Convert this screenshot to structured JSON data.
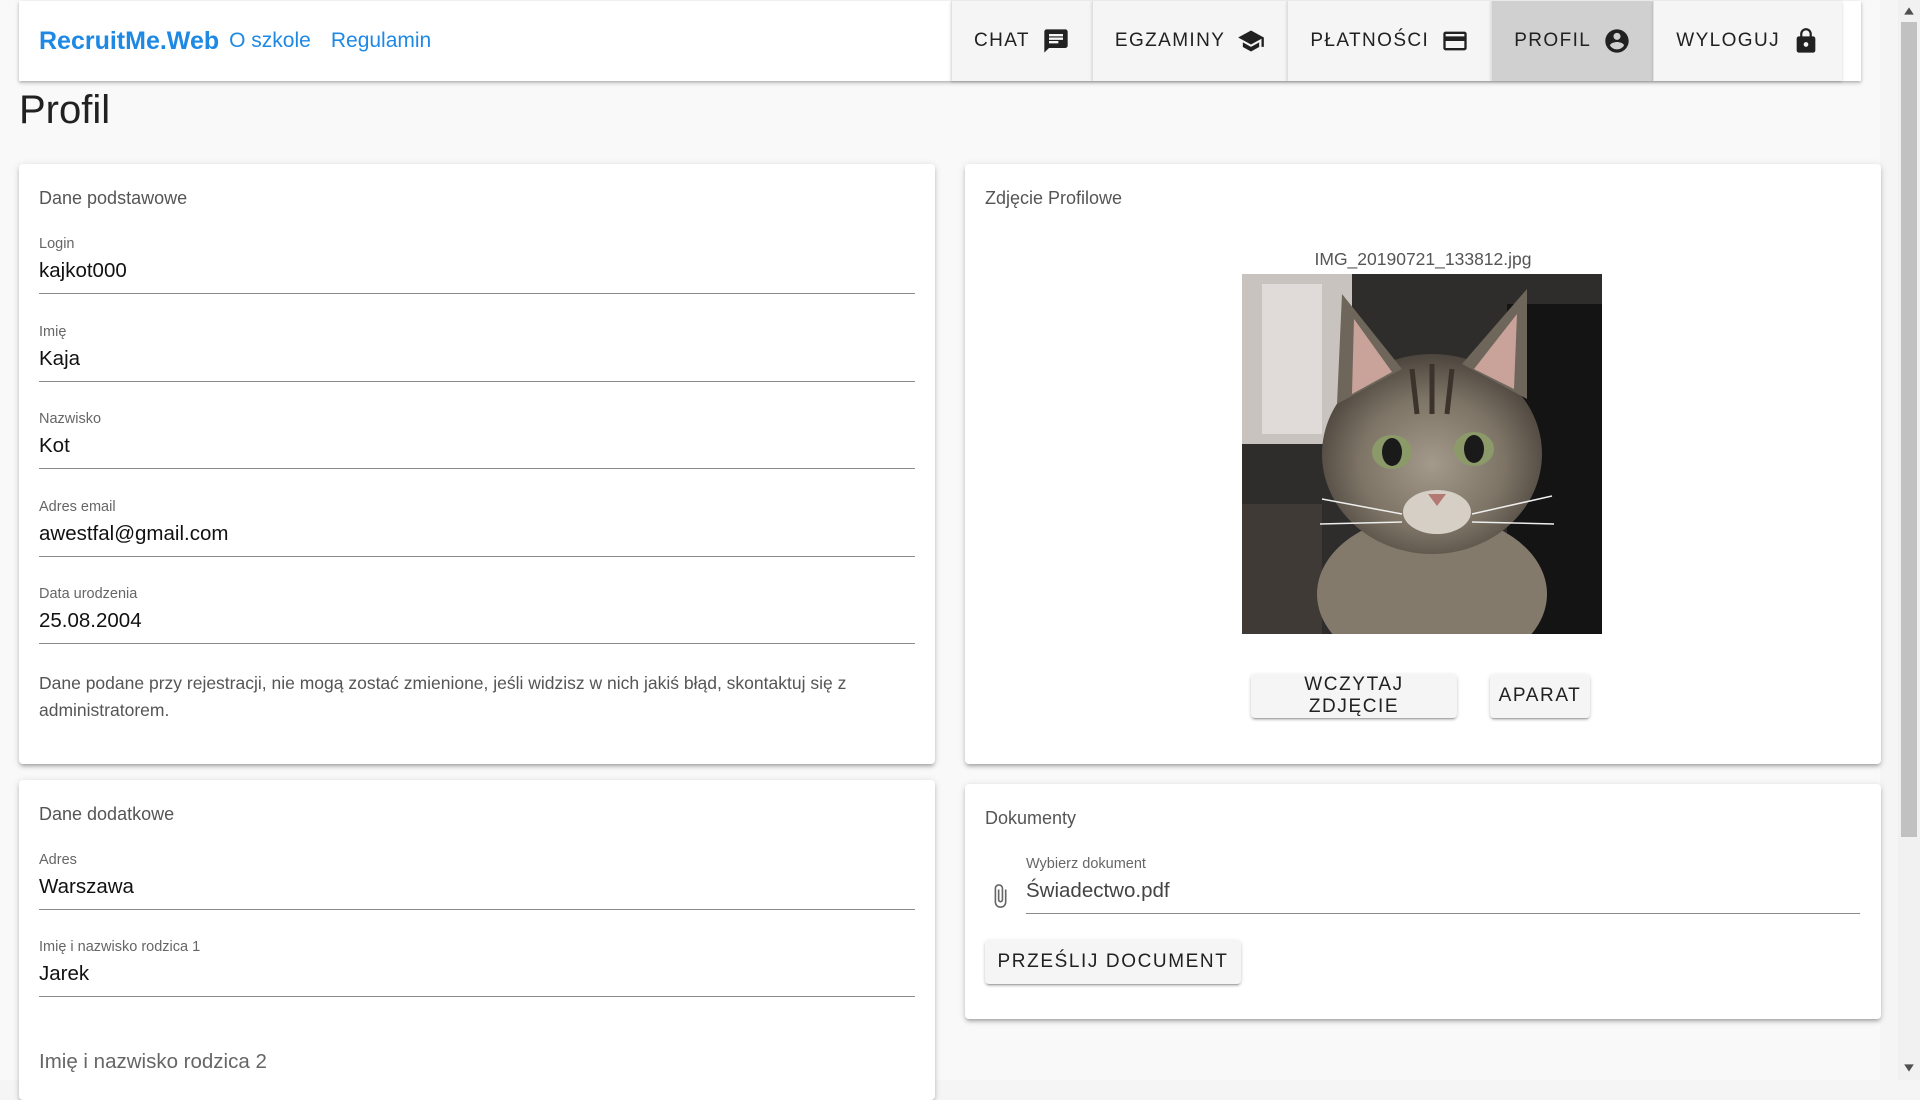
{
  "header": {
    "brand": "RecruitMe.Web",
    "links": [
      "O szkole",
      "Regulamin"
    ],
    "nav": {
      "chat": "CHAT",
      "exams": "EGZAMINY",
      "payments": "PŁATNOŚCI",
      "profile": "PROFIL",
      "logout": "WYLOGUJ"
    },
    "active": "PROFIL"
  },
  "page": {
    "title": "Profil"
  },
  "basic_data": {
    "title": "Dane podstawowe",
    "fields": [
      {
        "label": "Login",
        "value": "kajkot000"
      },
      {
        "label": "Imię",
        "value": "Kaja"
      },
      {
        "label": "Nazwisko",
        "value": "Kot"
      },
      {
        "label": "Adres email",
        "value": "awestfal@gmail.com"
      },
      {
        "label": "Data urodzenia",
        "value": "25.08.2004"
      }
    ],
    "note": "Dane podane przy rejestracji, nie mogą zostać zmienione, jeśli widzisz w nich jakiś błąd, skontaktuj się z administratorem."
  },
  "photo": {
    "title": "Zdjęcie Profilowe",
    "filename": "IMG_20190721_133812.jpg",
    "load_button": "WCZYTAJ ZDJĘCIE",
    "camera_button": "APARAT"
  },
  "extra_data": {
    "title": "Dane dodatkowe",
    "fields": [
      {
        "label": "Adres",
        "value": "Warszawa"
      },
      {
        "label": "Imię i nazwisko rodzica 1",
        "value": "Jarek"
      }
    ],
    "parent2_placeholder": "Imię i nazwisko rodzica 2"
  },
  "documents": {
    "title": "Dokumenty",
    "label": "Wybierz dokument",
    "value": "Świadectwo.pdf",
    "upload_button": "PRZEŚLIJ DOCUMENT"
  },
  "colors": {
    "accent": "#1e88e5",
    "active_tab": "#d0d0d0"
  }
}
